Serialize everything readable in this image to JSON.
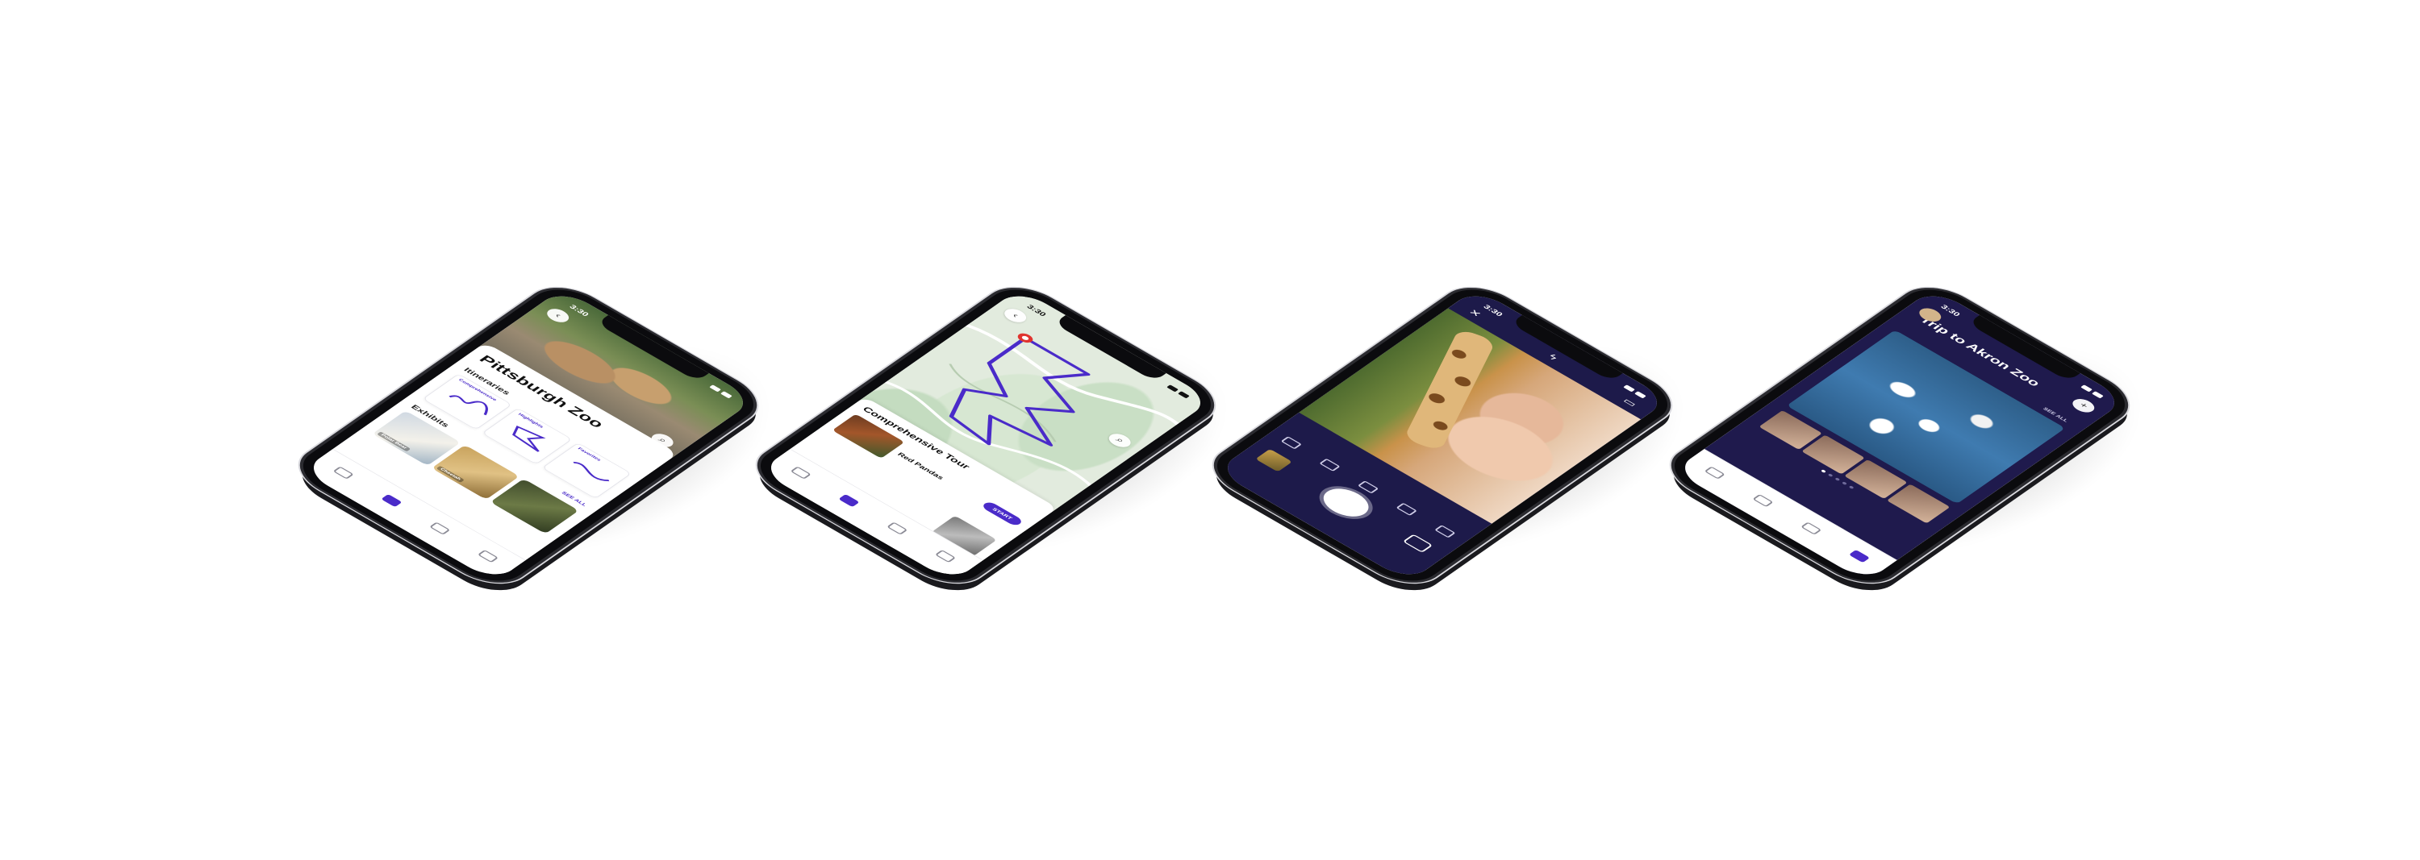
{
  "phones": [
    {
      "status_time": "3:30",
      "title": "Pittsburgh Zoo",
      "section_itineraries": "Itineraries",
      "itineraries": [
        {
          "name": "Comprehensive"
        },
        {
          "name": "Highlights"
        },
        {
          "name": "Favorites"
        }
      ],
      "section_exhibits": "Exhibits",
      "see_all": "SEE ALL",
      "exhibits": [
        {
          "name": "Polar Bear"
        },
        {
          "name": "Cheetah"
        },
        {
          "name": ""
        }
      ]
    },
    {
      "status_time": "3:30",
      "tour_title": "Comprehensive Tour",
      "stop_name": "Red Pandas",
      "start_label": "START"
    },
    {
      "status_time": "3:30"
    },
    {
      "status_time": "3:30",
      "album_title": "Trip to Akron Zoo",
      "see_all": "SEE ALL"
    }
  ],
  "colors": {
    "accent": "#4a2bc9",
    "dark_bg": "#1f1a4d",
    "map_green": "#c9dfc5"
  }
}
